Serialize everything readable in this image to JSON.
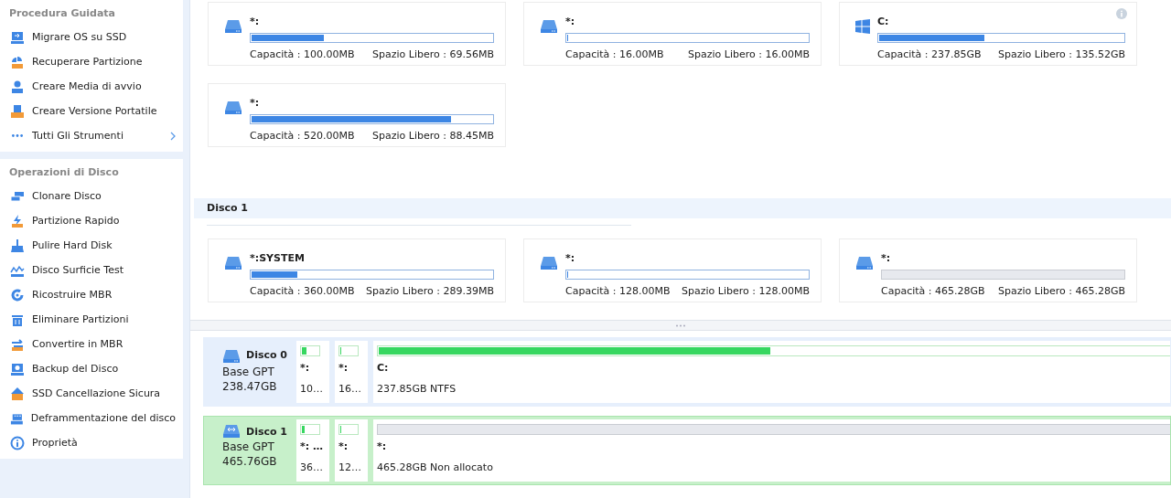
{
  "sidebar": {
    "sections": [
      {
        "title": "Procedura Guidata",
        "items": [
          {
            "label": "Migrare OS su SSD"
          },
          {
            "label": "Recuperare Partizione"
          },
          {
            "label": "Creare Media di avvio"
          },
          {
            "label": "Creare Versione Portatile"
          },
          {
            "label": "Tutti Gli Strumenti",
            "expandable": true
          }
        ]
      },
      {
        "title": "Operazioni di Disco",
        "items": [
          {
            "label": "Clonare Disco"
          },
          {
            "label": "Partizione Rapido"
          },
          {
            "label": "Pulire Hard Disk"
          },
          {
            "label": "Disco Surficie Test"
          },
          {
            "label": "Ricostruire MBR"
          },
          {
            "label": "Eliminare Partizioni"
          },
          {
            "label": "Convertire in MBR"
          },
          {
            "label": "Backup del Disco"
          },
          {
            "label": "SSD Cancellazione Sicura"
          },
          {
            "label": "Deframmentazione del disco"
          },
          {
            "label": "Proprietà"
          }
        ]
      }
    ]
  },
  "disk_groups": [
    {
      "partitions": [
        {
          "kind": "drive",
          "name": "*:",
          "level": 0.3,
          "capacity": "Capacità : 100.00MB",
          "free": "Spazio Libero : 69.56MB"
        },
        {
          "kind": "drive",
          "name": "*:",
          "level": 0,
          "capacity": "Capacità : 16.00MB",
          "free": "Spazio Libero : 16.00MB"
        },
        {
          "kind": "windows",
          "name": "C:",
          "level": 0.43,
          "capacity": "Capacità : 237.85GB",
          "free": "Spazio Libero : 135.52GB",
          "info": true
        },
        {
          "kind": "drive",
          "name": "*:",
          "level": 0.83,
          "capacity": "Capacità : 520.00MB",
          "free": "Spazio Libero : 88.45MB"
        }
      ]
    },
    {
      "title": "Disco 1",
      "partitions": [
        {
          "kind": "drive",
          "name": "*:SYSTEM",
          "level": 0.19,
          "capacity": "Capacità : 360.00MB",
          "free": "Spazio Libero : 289.39MB"
        },
        {
          "kind": "drive",
          "name": "*:",
          "level": 0,
          "capacity": "Capacità : 128.00MB",
          "free": "Spazio Libero : 128.00MB"
        },
        {
          "kind": "unallocated",
          "name": "*:",
          "capacity": "Capacità : 465.28GB",
          "free": "Spazio Libero : 465.28GB"
        }
      ]
    }
  ],
  "disk_map": [
    {
      "name": "Disco 0",
      "type": "Base GPT",
      "size": "238.47GB",
      "selected": false,
      "partitions": [
        {
          "kind": "small",
          "name": "*:",
          "size": "10…",
          "level": 0.3
        },
        {
          "kind": "small",
          "name": "*:",
          "size": "16…",
          "level": 0
        },
        {
          "kind": "wide",
          "name": "C:",
          "size": "237.85GB NTFS",
          "level": 0.43
        }
      ]
    },
    {
      "name": "Disco 1",
      "type": "Base GPT",
      "size": "465.76GB",
      "selected": true,
      "partitions": [
        {
          "kind": "small",
          "name": "*: …",
          "size": "36…",
          "level": 0.19
        },
        {
          "kind": "small",
          "name": "*:",
          "size": "12…",
          "level": 0
        },
        {
          "kind": "unallocated",
          "name": "*:",
          "size": "465.28GB Non allocato"
        }
      ]
    }
  ]
}
